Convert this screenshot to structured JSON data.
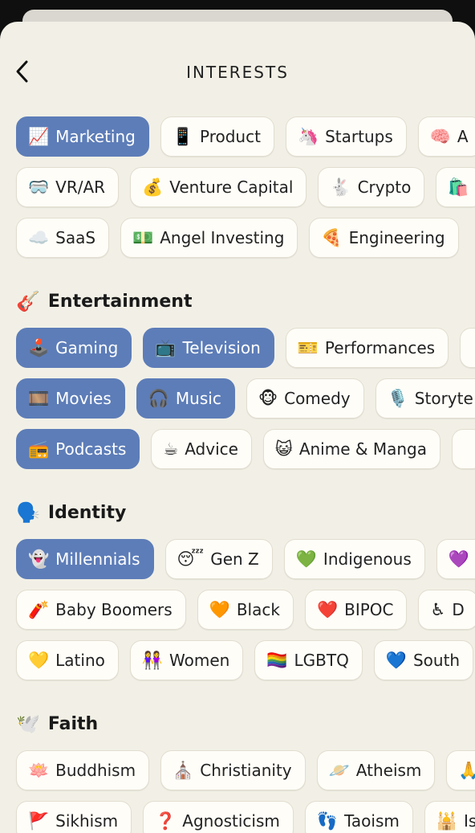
{
  "header": {
    "title": "INTERESTS",
    "back_icon": "chevron-left-icon"
  },
  "colors": {
    "selected": "#5d7db8",
    "chip_bg": "#fefdf8",
    "sheet_bg": "#f2f0e6"
  },
  "top_rows": [
    [
      {
        "label": "Marketing",
        "icon": "📈",
        "selected": true
      },
      {
        "label": "Product",
        "icon": "📱",
        "selected": false
      },
      {
        "label": "Startups",
        "icon": "🦄",
        "selected": false
      },
      {
        "label": "A",
        "icon": "🧠",
        "selected": false
      }
    ],
    [
      {
        "label": "VR/AR",
        "icon": "🥽",
        "selected": false
      },
      {
        "label": "Venture Capital",
        "icon": "💰",
        "selected": false
      },
      {
        "label": "Crypto",
        "icon": "🐇",
        "selected": false
      },
      {
        "label": "",
        "icon": "🛍️",
        "selected": false
      }
    ],
    [
      {
        "label": "SaaS",
        "icon": "☁️",
        "selected": false
      },
      {
        "label": "Angel Investing",
        "icon": "💵",
        "selected": false
      },
      {
        "label": "Engineering",
        "icon": "🍕",
        "selected": false
      }
    ]
  ],
  "sections": [
    {
      "title": "Entertainment",
      "icon": "🎸",
      "rows": [
        [
          {
            "label": "Gaming",
            "icon": "🕹️",
            "selected": true
          },
          {
            "label": "Television",
            "icon": "📺",
            "selected": true
          },
          {
            "label": "Performances",
            "icon": "🎫",
            "selected": false
          },
          {
            "label": "",
            "icon": "",
            "selected": false
          }
        ],
        [
          {
            "label": "Movies",
            "icon": "🎞️",
            "selected": true
          },
          {
            "label": "Music",
            "icon": "🎧",
            "selected": true
          },
          {
            "label": "Comedy",
            "icon": "🐵",
            "selected": false
          },
          {
            "label": "Storyte",
            "icon": "🎙️",
            "selected": false
          }
        ],
        [
          {
            "label": "Podcasts",
            "icon": "📻",
            "selected": true
          },
          {
            "label": "Advice",
            "icon": "☕",
            "selected": false
          },
          {
            "label": "Anime & Manga",
            "icon": "😺",
            "selected": false
          },
          {
            "label": "",
            "icon": "",
            "selected": false
          }
        ]
      ]
    },
    {
      "title": "Identity",
      "icon": "🗣️",
      "rows": [
        [
          {
            "label": "Millennials",
            "icon": "👻",
            "selected": true
          },
          {
            "label": "Gen Z",
            "icon": "😴",
            "selected": false
          },
          {
            "label": "Indigenous",
            "icon": "💚",
            "selected": false
          },
          {
            "label": "I",
            "icon": "💜",
            "selected": false
          }
        ],
        [
          {
            "label": "Baby Boomers",
            "icon": "🧨",
            "selected": false
          },
          {
            "label": "Black",
            "icon": "🧡",
            "selected": false
          },
          {
            "label": "BIPOC",
            "icon": "❤️",
            "selected": false
          },
          {
            "label": "D",
            "icon": "♿",
            "selected": false
          }
        ],
        [
          {
            "label": "Latino",
            "icon": "💛",
            "selected": false
          },
          {
            "label": "Women",
            "icon": "👭",
            "selected": false
          },
          {
            "label": "LGBTQ",
            "icon": "🏳️‍🌈",
            "selected": false
          },
          {
            "label": "South",
            "icon": "💙",
            "selected": false
          }
        ]
      ]
    },
    {
      "title": "Faith",
      "icon": "🕊️",
      "rows": [
        [
          {
            "label": "Buddhism",
            "icon": "🪷",
            "selected": false
          },
          {
            "label": "Christianity",
            "icon": "⛪",
            "selected": false
          },
          {
            "label": "Atheism",
            "icon": "🪐",
            "selected": false
          },
          {
            "label": "",
            "icon": "🙏",
            "selected": false
          }
        ],
        [
          {
            "label": "Sikhism",
            "icon": "🚩",
            "selected": false
          },
          {
            "label": "Agnosticism",
            "icon": "❓",
            "selected": false
          },
          {
            "label": "Taoism",
            "icon": "👣",
            "selected": false
          },
          {
            "label": "Is",
            "icon": "🕌",
            "selected": false
          }
        ]
      ]
    }
  ]
}
